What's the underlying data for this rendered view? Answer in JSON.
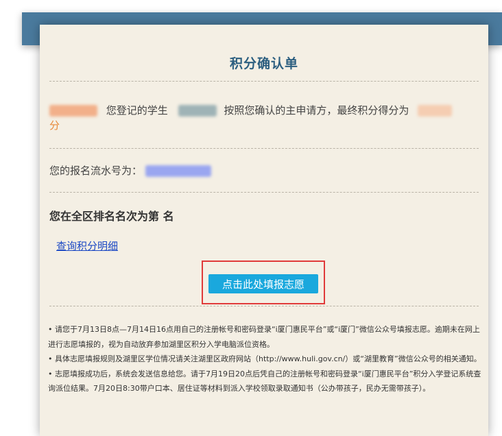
{
  "title": "积分确认单",
  "confirm": {
    "text_mid": "您登记的学生",
    "text_after": "按照您确认的主申请方，最终积分得分为",
    "unit": "分"
  },
  "serial": {
    "label": "您的报名流水号为："
  },
  "rank": {
    "text": "您在全区排名名次为第  名"
  },
  "link_label": "查询积分明细",
  "button_label": "点击此处填报志愿",
  "notes": [
    "• 请您于7月13日8点—7月14日16点用自己的注册帐号和密码登录“i厦门惠民平台”或“i厦门”微信公众号填报志愿。逾期未在网上进行志愿填报的，视为自动放弃参加湖里区积分入学电脑派位资格。",
    "• 具体志愿填报规则及湖里区学位情况请关注湖里区政府网站（http://www.huli.gov.cn/）或“湖里教育”微信公众号的相关通知。",
    "• 志愿填报成功后，系统会发送信息给您。请于7月19日20点后凭自己的注册帐号和密码登录“i厦门惠民平台”积分入学登记系统查询派位结果。7月20日8:30带户口本、居住证等材料到派入学校领取录取通知书（公办带孩子，民办无需带孩子）。"
  ]
}
